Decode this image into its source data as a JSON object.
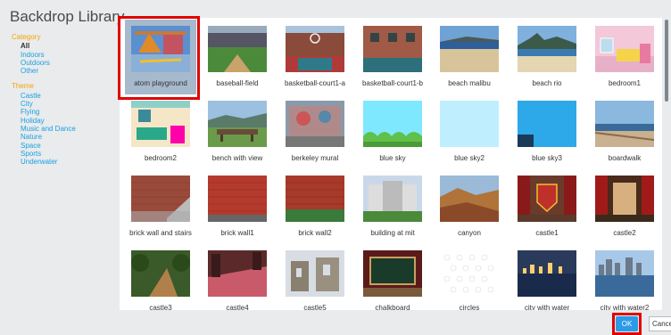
{
  "dialog": {
    "title": "Backdrop Library"
  },
  "sidebar": {
    "category_heading": "Category",
    "categories": [
      "All",
      "Indoors",
      "Outdoors",
      "Other"
    ],
    "theme_heading": "Theme",
    "themes": [
      "Castle",
      "City",
      "Flying",
      "Holiday",
      "Music and Dance",
      "Nature",
      "Space",
      "Sports",
      "Underwater"
    ]
  },
  "backdrops": [
    {
      "label": "atom playground",
      "icon": "playground-image"
    },
    {
      "label": "baseball-field",
      "icon": "baseball-field-image"
    },
    {
      "label": "basketball-court1-a",
      "icon": "basketball-court-image"
    },
    {
      "label": "basketball-court1-b",
      "icon": "brick-building-image"
    },
    {
      "label": "beach malibu",
      "icon": "beach-image"
    },
    {
      "label": "beach rio",
      "icon": "beach-mountain-image"
    },
    {
      "label": "bedroom1",
      "icon": "bedroom-image"
    },
    {
      "label": "bedroom2",
      "icon": "bedroom-image"
    },
    {
      "label": "bench with view",
      "icon": "bench-image"
    },
    {
      "label": "berkeley mural",
      "icon": "mural-image"
    },
    {
      "label": "blue sky",
      "icon": "blue-sky-hills-image"
    },
    {
      "label": "blue sky2",
      "icon": "blue-sky-image"
    },
    {
      "label": "blue sky3",
      "icon": "blue-sky-image"
    },
    {
      "label": "boardwalk",
      "icon": "boardwalk-image"
    },
    {
      "label": "brick wall and stairs",
      "icon": "brick-stairs-image"
    },
    {
      "label": "brick wall1",
      "icon": "brick-wall-image"
    },
    {
      "label": "brick wall2",
      "icon": "brick-wall-grass-image"
    },
    {
      "label": "building at mit",
      "icon": "building-image"
    },
    {
      "label": "canyon",
      "icon": "canyon-image"
    },
    {
      "label": "castle1",
      "icon": "castle-shield-image"
    },
    {
      "label": "castle2",
      "icon": "castle-curtain-image"
    },
    {
      "label": "castle3",
      "icon": "forest-path-image"
    },
    {
      "label": "castle4",
      "icon": "castle-hall-image"
    },
    {
      "label": "castle5",
      "icon": "castle-ruins-image"
    },
    {
      "label": "chalkboard",
      "icon": "chalkboard-image"
    },
    {
      "label": "circles",
      "icon": "circles-pattern-image"
    },
    {
      "label": "city with water",
      "icon": "city-night-image"
    },
    {
      "label": "city with water2",
      "icon": "city-day-image"
    }
  ],
  "buttons": {
    "ok": "OK",
    "cancel": "Cancel"
  }
}
